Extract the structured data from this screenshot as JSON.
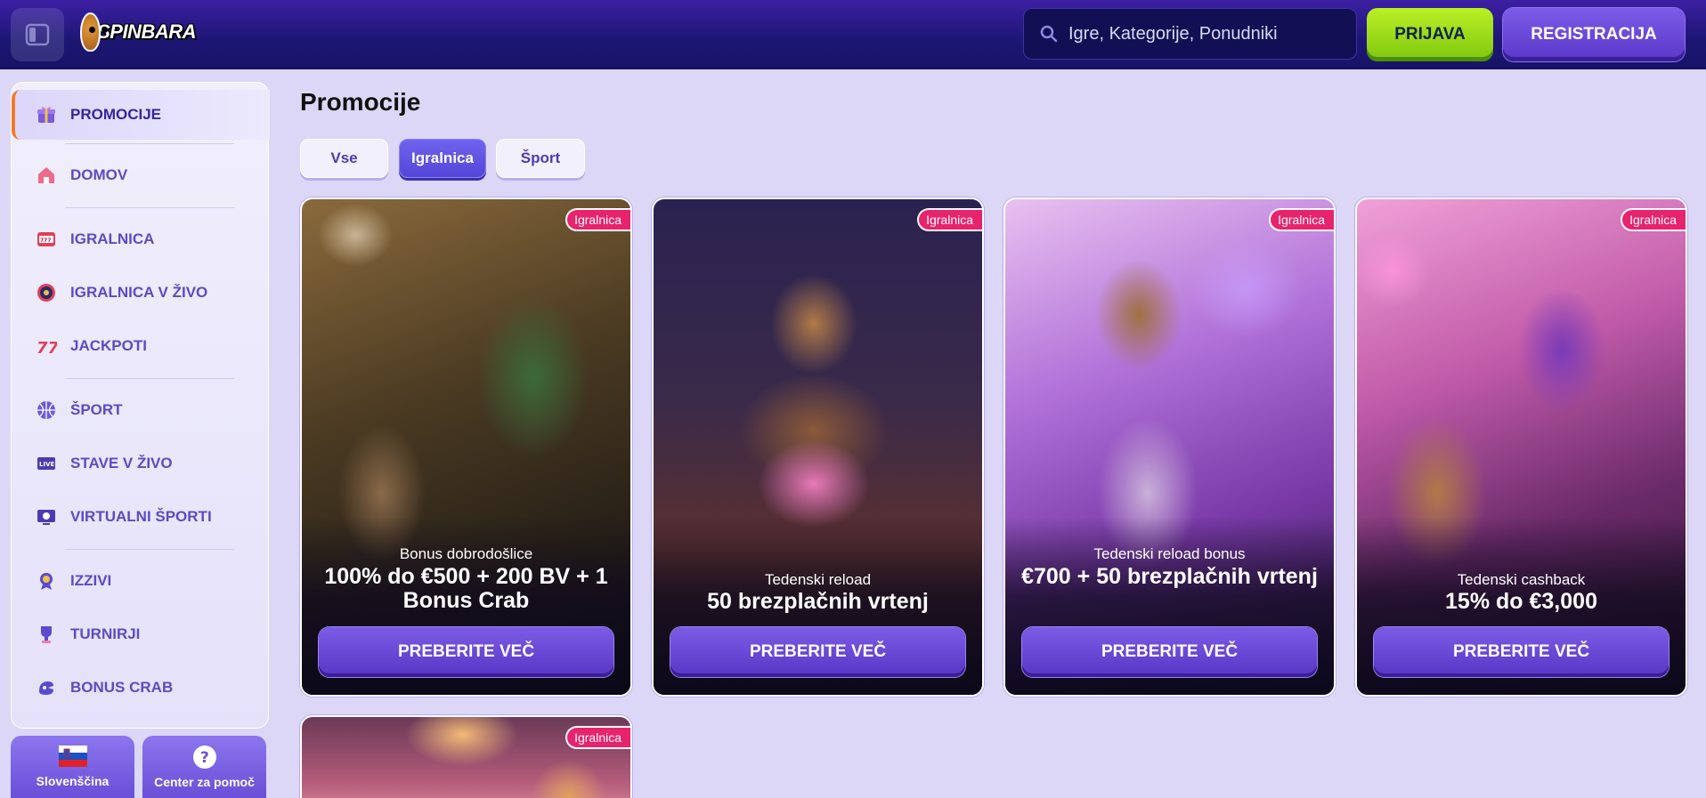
{
  "header": {
    "logo_text": "SPINBARA",
    "search_placeholder": "Igre, Kategorije, Ponudniki",
    "login_label": "PRIJAVA",
    "register_label": "REGISTRACIJA"
  },
  "sidebar": {
    "items": [
      {
        "label": "PROMOCIJE",
        "icon": "gift-icon",
        "active": true
      },
      {
        "label": "DOMOV",
        "icon": "home-icon"
      },
      {
        "label": "IGRALNICA",
        "icon": "slot-machine-icon"
      },
      {
        "label": "IGRALNICA V ŽIVO",
        "icon": "roulette-icon"
      },
      {
        "label": "JACKPOTI",
        "icon": "sevens-icon"
      },
      {
        "label": "ŠPORT",
        "icon": "basketball-icon"
      },
      {
        "label": "STAVE V ŽIVO",
        "icon": "live-icon"
      },
      {
        "label": "VIRTUALNI ŠPORTI",
        "icon": "virtual-icon"
      },
      {
        "label": "IZZIVI",
        "icon": "medal-icon"
      },
      {
        "label": "TURNIRJI",
        "icon": "trophy-icon"
      },
      {
        "label": "BONUS CRAB",
        "icon": "crab-icon"
      }
    ],
    "language_label": "Slovenščina",
    "help_label": "Center za pomoč"
  },
  "main": {
    "title": "Promocije",
    "tabs": [
      {
        "label": "Vse",
        "active": false
      },
      {
        "label": "Igralnica",
        "active": true
      },
      {
        "label": "Šport",
        "active": false
      }
    ],
    "cards": [
      {
        "badge": "Igralnica",
        "subtitle": "Bonus dobrodošlice",
        "headline": "100% do €500 + 200 BV + 1 Bonus Crab",
        "cta": "PREBERITE VEČ"
      },
      {
        "badge": "Igralnica",
        "subtitle": "Tedenski reload",
        "headline": "50 brezplačnih vrtenj",
        "cta": "PREBERITE VEČ"
      },
      {
        "badge": "Igralnica",
        "subtitle": "Tedenski reload bonus",
        "headline": "€700 + 50 brezplačnih vrtenj",
        "cta": "PREBERITE VEČ"
      },
      {
        "badge": "Igralnica",
        "subtitle": "Tedenski cashback",
        "headline": "15% do €3,000",
        "cta": "PREBERITE VEČ"
      },
      {
        "badge": "Igralnica"
      }
    ]
  },
  "colors": {
    "accent": "#5a37c9",
    "login": "#9ee01a",
    "badge": "#e8236d",
    "page_bg": "#dcd7f7"
  }
}
